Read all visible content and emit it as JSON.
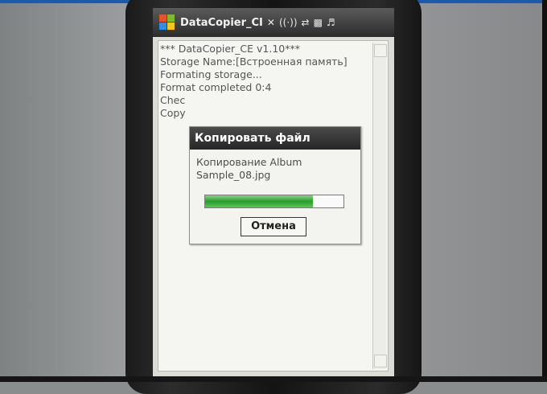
{
  "statusbar": {
    "title": "DataCopier_CI",
    "icons": [
      "windows-flag-icon",
      "connectivity-icon",
      "wifi-icon",
      "sync-icon",
      "signal-icon",
      "volume-icon"
    ]
  },
  "log": {
    "lines": [
      "*** DataCopier_CE v1.10***",
      "Storage Name:[Встроенная память]",
      "Formating storage...",
      "Format completed 0:4",
      "Chec",
      "Copy"
    ]
  },
  "dialog": {
    "title": "Копировать файл",
    "message": "Копирование Album Sample_08.jpg",
    "progress": 0.78,
    "cancel_label": "Отмена"
  },
  "colors": {
    "progress_green": "#2a9d2a",
    "titlebar": "#2b2b2b",
    "accent_rule": "#1f5aa8"
  }
}
